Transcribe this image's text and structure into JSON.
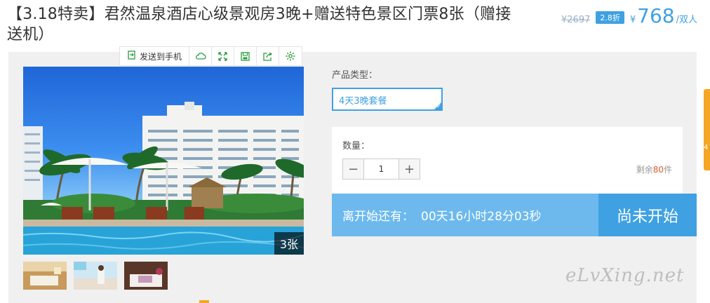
{
  "title": "【3.18特卖】君然温泉酒店心级景观房3晚+赠送特色景区门票8张（赠接送机）",
  "price": {
    "original": "¥2697",
    "discount": "2.8折",
    "currency": "¥",
    "current": "768",
    "unit": "/双人",
    "accent_color": "#3fa1e2"
  },
  "toolbar": {
    "send_to_phone": "发送到手机",
    "icons": [
      "cloud-icon",
      "expand-icon",
      "save-icon",
      "share-icon",
      "settings-icon"
    ]
  },
  "gallery": {
    "photo_count": "3张",
    "thumbnails": [
      "room-thumbnail",
      "beach-thumbnail",
      "bedroom-thumbnail"
    ]
  },
  "product": {
    "type_label": "产品类型：",
    "selected_type": "4天3晚套餐"
  },
  "quantity": {
    "label": "数量：",
    "minus": "−",
    "value": "1",
    "plus": "+",
    "stock_prefix": "剩余",
    "stock_count": "80",
    "stock_suffix": "件"
  },
  "countdown": {
    "label": "离开始还有：",
    "time": "00天16小时28分03秒"
  },
  "start_button": "尚未开始",
  "side_tab_text": "4",
  "watermark": "eLvXing.net"
}
